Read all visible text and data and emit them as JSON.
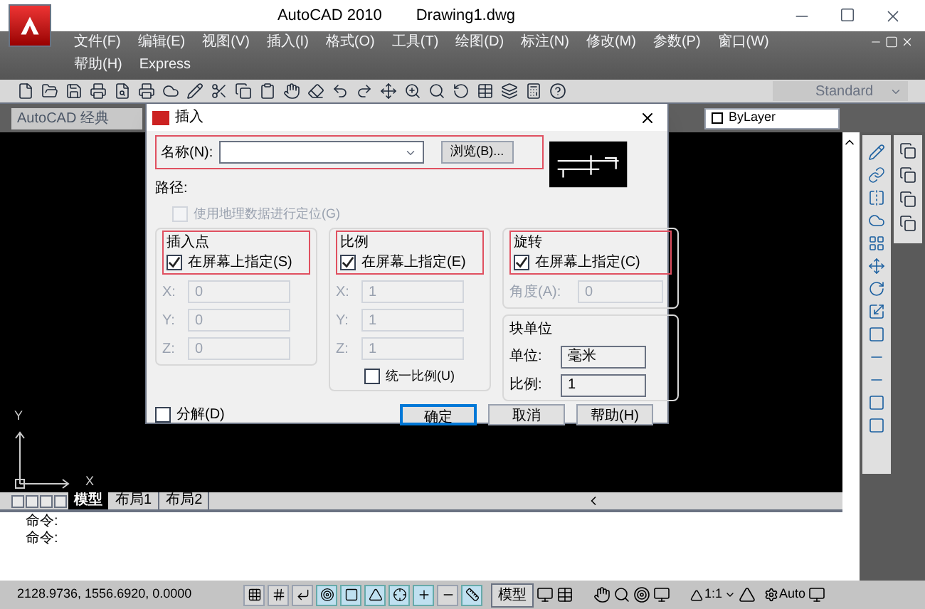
{
  "window": {
    "title": "AutoCAD 2010",
    "document": "Drawing1.dwg"
  },
  "menu": [
    {
      "label": "文件(F)"
    },
    {
      "label": "编辑(E)"
    },
    {
      "label": "视图(V)"
    },
    {
      "label": "插入(I)"
    },
    {
      "label": "格式(O)"
    },
    {
      "label": "工具(T)"
    },
    {
      "label": "绘图(D)"
    },
    {
      "label": "标注(N)"
    },
    {
      "label": "修改(M)"
    },
    {
      "label": "参数(P)"
    },
    {
      "label": "窗口(W)"
    },
    {
      "label": "帮助(H)"
    },
    {
      "label": "Express"
    }
  ],
  "toolbar": {
    "style_select": "Standard"
  },
  "workspace_select": "AutoCAD 经典",
  "layer_select": "ByLayer",
  "dialog": {
    "title": "插入",
    "name_label": "名称(N):",
    "browse": "浏览(B)...",
    "path_label": "路径:",
    "geo_option": {
      "label": "使用地理数据进行定位(G)",
      "checked": false,
      "disabled": true
    },
    "groups": [
      {
        "title": "插入点",
        "specify": {
          "label": "在屏幕上指定(S)",
          "checked": true
        },
        "fields": [
          {
            "label": "X:",
            "value": "0",
            "disabled": true
          },
          {
            "label": "Y:",
            "value": "0",
            "disabled": true
          },
          {
            "label": "Z:",
            "value": "0",
            "disabled": true
          }
        ]
      },
      {
        "title": "比例",
        "specify": {
          "label": "在屏幕上指定(E)",
          "checked": true
        },
        "fields": [
          {
            "label": "X:",
            "value": "1",
            "disabled": true
          },
          {
            "label": "Y:",
            "value": "1",
            "disabled": true
          },
          {
            "label": "Z:",
            "value": "1",
            "disabled": true
          }
        ],
        "uniform": {
          "label": "统一比例(U)",
          "checked": false
        }
      },
      {
        "title": "旋转",
        "specify": {
          "label": "在屏幕上指定(C)",
          "checked": true
        },
        "fields": [
          {
            "label": "角度(A):",
            "value": "0",
            "disabled": true
          }
        ]
      }
    ],
    "block_unit": {
      "title": "块单位",
      "unit_label": "单位:",
      "unit_value": "毫米",
      "scale_label": "比例:",
      "scale_value": "1"
    },
    "explode": {
      "label": "分解(D)",
      "checked": false
    },
    "buttons": [
      {
        "label": "确定",
        "default": true
      },
      {
        "label": "取消",
        "default": false
      },
      {
        "label": "帮助(H)",
        "default": false
      }
    ]
  },
  "layout_tabs": [
    {
      "label": "模型",
      "selected": true
    },
    {
      "label": "布局1",
      "selected": false
    },
    {
      "label": "布局2",
      "selected": false
    }
  ],
  "command_lines": [
    "命令:",
    "命令:"
  ],
  "ucs": {
    "x_label": "X",
    "y_label": "Y"
  },
  "status_bar": {
    "coordinates": "2128.9736, 1556.6920, 0.0000",
    "toggles": [
      {
        "on": false
      },
      {
        "on": false
      },
      {
        "on": false
      },
      {
        "on": true
      },
      {
        "on": true
      },
      {
        "on": true
      },
      {
        "on": true
      },
      {
        "on": true
      },
      {
        "on": false
      },
      {
        "on": true
      }
    ],
    "model": "模型",
    "scale": "1:1",
    "auto": "Auto"
  }
}
